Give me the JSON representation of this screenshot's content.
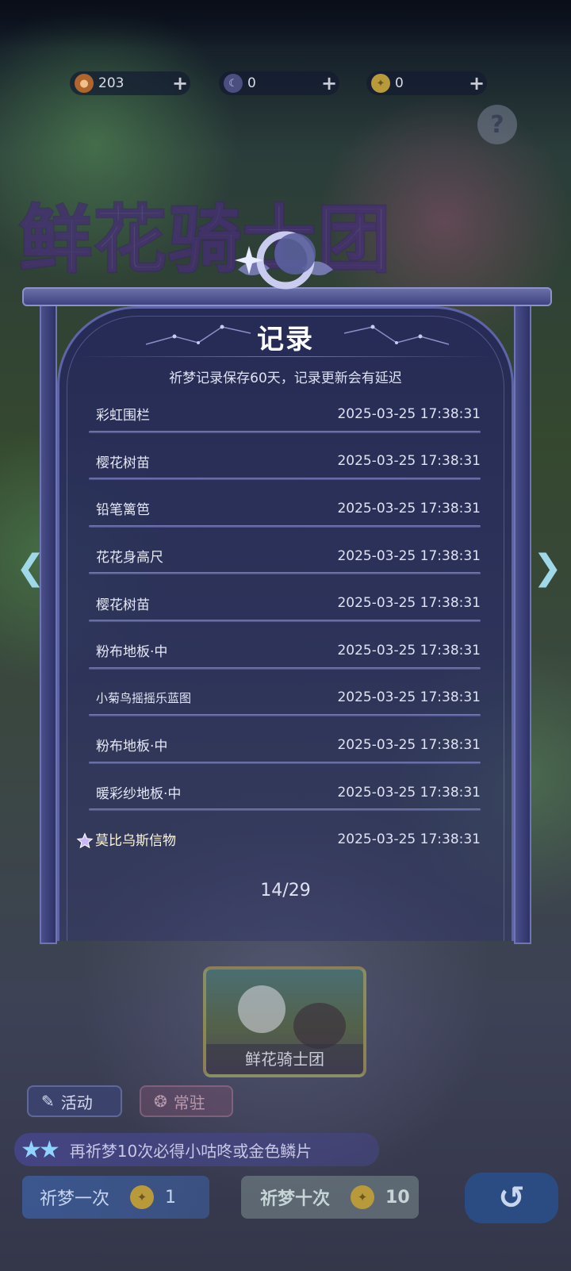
{
  "currencies": [
    {
      "icon": "fruit-coin-icon",
      "value": "203"
    },
    {
      "icon": "moon-coin-icon",
      "value": "0"
    },
    {
      "icon": "gold-scale-icon",
      "value": "0"
    }
  ],
  "background": {
    "event_title": "鲜花骑士团"
  },
  "panel": {
    "title": "记录",
    "subtitle": "祈梦记录保存60天，记录更新会有延迟",
    "records": [
      {
        "name": "彩虹围栏",
        "time": "2025-03-25 17:38:31"
      },
      {
        "name": "樱花树苗",
        "time": "2025-03-25 17:38:31"
      },
      {
        "name": "铅笔篱笆",
        "time": "2025-03-25 17:38:31"
      },
      {
        "name": "花花身高尺",
        "time": "2025-03-25 17:38:31"
      },
      {
        "name": "樱花树苗",
        "time": "2025-03-25 17:38:31"
      },
      {
        "name": "粉布地板·中",
        "time": "2025-03-25 17:38:31"
      },
      {
        "name": "小菊鸟摇摇乐蓝图",
        "time": "2025-03-25 17:38:31"
      },
      {
        "name": "粉布地板·中",
        "time": "2025-03-25 17:38:31"
      },
      {
        "name": "暖彩纱地板·中",
        "time": "2025-03-25 17:38:31"
      },
      {
        "name": "莫比乌斯信物",
        "time": "2025-03-25 17:38:31",
        "special": true
      }
    ],
    "pager": "14/29"
  },
  "bottom": {
    "card_label": "鲜花骑士团",
    "tab_activity": "活动",
    "tab_permanent": "常驻",
    "promo_text": "再祈梦10次必得小咕咚或金色鳞片",
    "pray_once_label": "祈梦一次",
    "pray_once_cost": "1",
    "pray_ten_label": "祈梦十次",
    "pray_ten_cost": "10"
  },
  "colors": {
    "panel_bg": "#2a2e60",
    "accent_line": "#8a90c8",
    "text": "#e6e8f6"
  }
}
